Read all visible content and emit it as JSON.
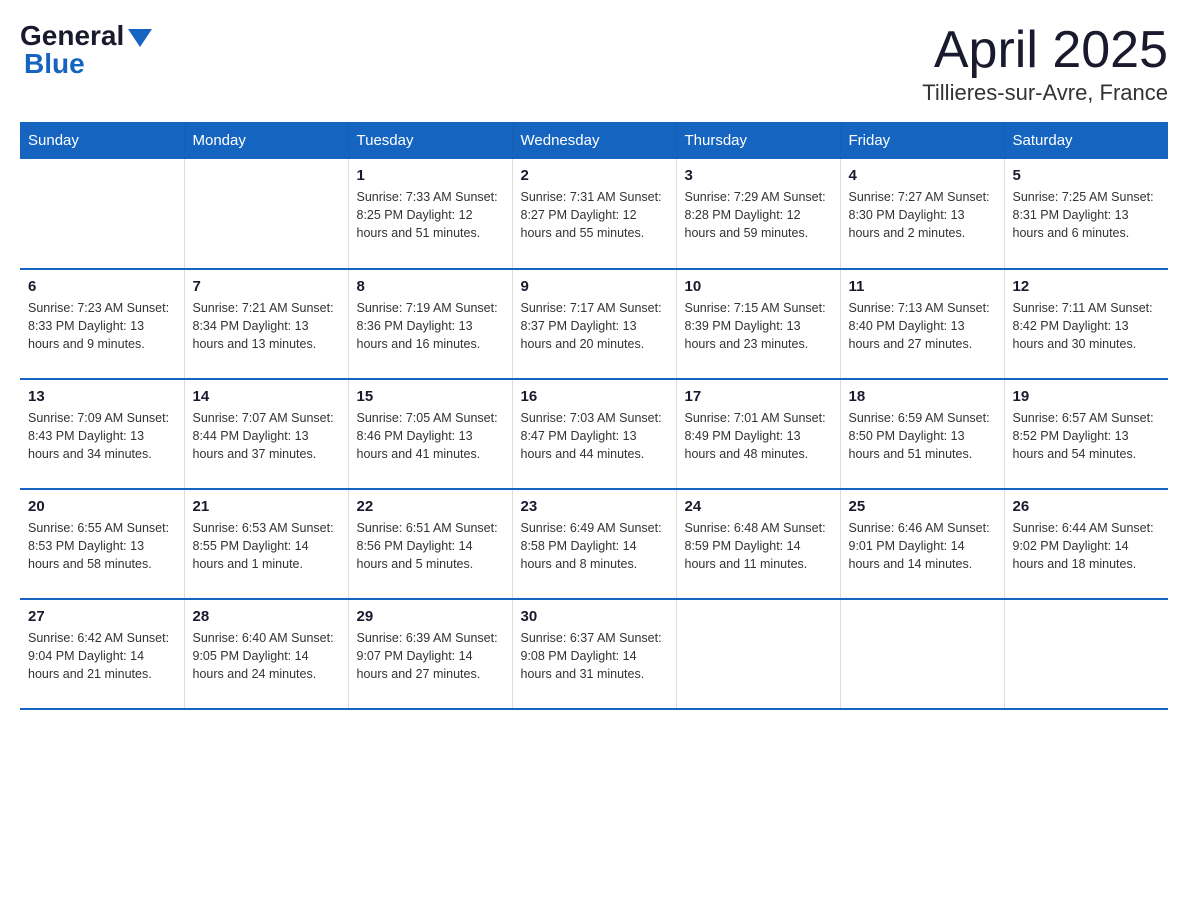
{
  "logo": {
    "general": "General",
    "blue": "Blue"
  },
  "title": "April 2025",
  "subtitle": "Tillieres-sur-Avre, France",
  "headers": [
    "Sunday",
    "Monday",
    "Tuesday",
    "Wednesday",
    "Thursday",
    "Friday",
    "Saturday"
  ],
  "weeks": [
    [
      {
        "day": "",
        "info": ""
      },
      {
        "day": "",
        "info": ""
      },
      {
        "day": "1",
        "info": "Sunrise: 7:33 AM\nSunset: 8:25 PM\nDaylight: 12 hours\nand 51 minutes."
      },
      {
        "day": "2",
        "info": "Sunrise: 7:31 AM\nSunset: 8:27 PM\nDaylight: 12 hours\nand 55 minutes."
      },
      {
        "day": "3",
        "info": "Sunrise: 7:29 AM\nSunset: 8:28 PM\nDaylight: 12 hours\nand 59 minutes."
      },
      {
        "day": "4",
        "info": "Sunrise: 7:27 AM\nSunset: 8:30 PM\nDaylight: 13 hours\nand 2 minutes."
      },
      {
        "day": "5",
        "info": "Sunrise: 7:25 AM\nSunset: 8:31 PM\nDaylight: 13 hours\nand 6 minutes."
      }
    ],
    [
      {
        "day": "6",
        "info": "Sunrise: 7:23 AM\nSunset: 8:33 PM\nDaylight: 13 hours\nand 9 minutes."
      },
      {
        "day": "7",
        "info": "Sunrise: 7:21 AM\nSunset: 8:34 PM\nDaylight: 13 hours\nand 13 minutes."
      },
      {
        "day": "8",
        "info": "Sunrise: 7:19 AM\nSunset: 8:36 PM\nDaylight: 13 hours\nand 16 minutes."
      },
      {
        "day": "9",
        "info": "Sunrise: 7:17 AM\nSunset: 8:37 PM\nDaylight: 13 hours\nand 20 minutes."
      },
      {
        "day": "10",
        "info": "Sunrise: 7:15 AM\nSunset: 8:39 PM\nDaylight: 13 hours\nand 23 minutes."
      },
      {
        "day": "11",
        "info": "Sunrise: 7:13 AM\nSunset: 8:40 PM\nDaylight: 13 hours\nand 27 minutes."
      },
      {
        "day": "12",
        "info": "Sunrise: 7:11 AM\nSunset: 8:42 PM\nDaylight: 13 hours\nand 30 minutes."
      }
    ],
    [
      {
        "day": "13",
        "info": "Sunrise: 7:09 AM\nSunset: 8:43 PM\nDaylight: 13 hours\nand 34 minutes."
      },
      {
        "day": "14",
        "info": "Sunrise: 7:07 AM\nSunset: 8:44 PM\nDaylight: 13 hours\nand 37 minutes."
      },
      {
        "day": "15",
        "info": "Sunrise: 7:05 AM\nSunset: 8:46 PM\nDaylight: 13 hours\nand 41 minutes."
      },
      {
        "day": "16",
        "info": "Sunrise: 7:03 AM\nSunset: 8:47 PM\nDaylight: 13 hours\nand 44 minutes."
      },
      {
        "day": "17",
        "info": "Sunrise: 7:01 AM\nSunset: 8:49 PM\nDaylight: 13 hours\nand 48 minutes."
      },
      {
        "day": "18",
        "info": "Sunrise: 6:59 AM\nSunset: 8:50 PM\nDaylight: 13 hours\nand 51 minutes."
      },
      {
        "day": "19",
        "info": "Sunrise: 6:57 AM\nSunset: 8:52 PM\nDaylight: 13 hours\nand 54 minutes."
      }
    ],
    [
      {
        "day": "20",
        "info": "Sunrise: 6:55 AM\nSunset: 8:53 PM\nDaylight: 13 hours\nand 58 minutes."
      },
      {
        "day": "21",
        "info": "Sunrise: 6:53 AM\nSunset: 8:55 PM\nDaylight: 14 hours\nand 1 minute."
      },
      {
        "day": "22",
        "info": "Sunrise: 6:51 AM\nSunset: 8:56 PM\nDaylight: 14 hours\nand 5 minutes."
      },
      {
        "day": "23",
        "info": "Sunrise: 6:49 AM\nSunset: 8:58 PM\nDaylight: 14 hours\nand 8 minutes."
      },
      {
        "day": "24",
        "info": "Sunrise: 6:48 AM\nSunset: 8:59 PM\nDaylight: 14 hours\nand 11 minutes."
      },
      {
        "day": "25",
        "info": "Sunrise: 6:46 AM\nSunset: 9:01 PM\nDaylight: 14 hours\nand 14 minutes."
      },
      {
        "day": "26",
        "info": "Sunrise: 6:44 AM\nSunset: 9:02 PM\nDaylight: 14 hours\nand 18 minutes."
      }
    ],
    [
      {
        "day": "27",
        "info": "Sunrise: 6:42 AM\nSunset: 9:04 PM\nDaylight: 14 hours\nand 21 minutes."
      },
      {
        "day": "28",
        "info": "Sunrise: 6:40 AM\nSunset: 9:05 PM\nDaylight: 14 hours\nand 24 minutes."
      },
      {
        "day": "29",
        "info": "Sunrise: 6:39 AM\nSunset: 9:07 PM\nDaylight: 14 hours\nand 27 minutes."
      },
      {
        "day": "30",
        "info": "Sunrise: 6:37 AM\nSunset: 9:08 PM\nDaylight: 14 hours\nand 31 minutes."
      },
      {
        "day": "",
        "info": ""
      },
      {
        "day": "",
        "info": ""
      },
      {
        "day": "",
        "info": ""
      }
    ]
  ]
}
